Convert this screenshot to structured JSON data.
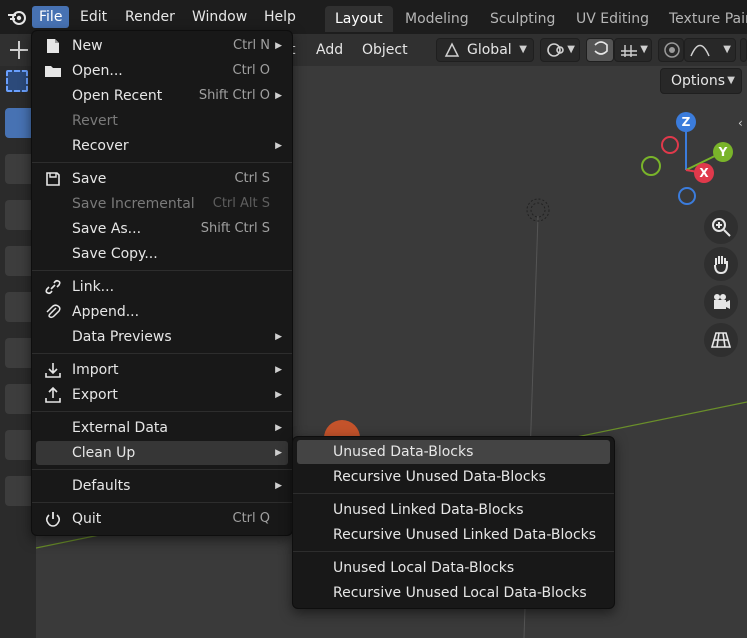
{
  "topbar": {
    "menus": [
      "File",
      "Edit",
      "Render",
      "Window",
      "Help"
    ],
    "workspaces": [
      "Layout",
      "Modeling",
      "Sculpting",
      "UV Editing",
      "Texture Paint"
    ]
  },
  "header": {
    "add_label": "Add",
    "object_label": "Object",
    "orientation": "Global",
    "partial_label": "t"
  },
  "viewport": {
    "options_label": "Options",
    "gizmo": {
      "z": "Z",
      "y": "Y",
      "x": "X"
    }
  },
  "file_menu": {
    "items": [
      {
        "label": "New",
        "shortcut": "Ctrl N",
        "submenu": true,
        "disabled": false,
        "icon": "new-file-icon"
      },
      {
        "label": "Open...",
        "shortcut": "Ctrl O",
        "submenu": false,
        "disabled": false,
        "icon": "folder-icon"
      },
      {
        "label": "Open Recent",
        "shortcut": "Shift Ctrl O",
        "submenu": true,
        "disabled": false,
        "icon": ""
      },
      {
        "label": "Revert",
        "shortcut": "",
        "submenu": false,
        "disabled": true,
        "icon": ""
      },
      {
        "label": "Recover",
        "shortcut": "",
        "submenu": true,
        "disabled": false,
        "icon": ""
      },
      {
        "label": "Save",
        "shortcut": "Ctrl S",
        "submenu": false,
        "disabled": false,
        "icon": "save-icon"
      },
      {
        "label": "Save Incremental",
        "shortcut": "Ctrl Alt S",
        "submenu": false,
        "disabled": true,
        "icon": ""
      },
      {
        "label": "Save As...",
        "shortcut": "Shift Ctrl S",
        "submenu": false,
        "disabled": false,
        "icon": ""
      },
      {
        "label": "Save Copy...",
        "shortcut": "",
        "submenu": false,
        "disabled": false,
        "icon": ""
      },
      {
        "label": "Link...",
        "shortcut": "",
        "submenu": false,
        "disabled": false,
        "icon": "link-icon"
      },
      {
        "label": "Append...",
        "shortcut": "",
        "submenu": false,
        "disabled": false,
        "icon": "paperclip-icon"
      },
      {
        "label": "Data Previews",
        "shortcut": "",
        "submenu": true,
        "disabled": false,
        "icon": ""
      },
      {
        "label": "Import",
        "shortcut": "",
        "submenu": true,
        "disabled": false,
        "icon": "import-icon"
      },
      {
        "label": "Export",
        "shortcut": "",
        "submenu": true,
        "disabled": false,
        "icon": "export-icon"
      },
      {
        "label": "External Data",
        "shortcut": "",
        "submenu": true,
        "disabled": false,
        "icon": ""
      },
      {
        "label": "Clean Up",
        "shortcut": "",
        "submenu": true,
        "disabled": false,
        "icon": ""
      },
      {
        "label": "Defaults",
        "shortcut": "",
        "submenu": true,
        "disabled": false,
        "icon": ""
      },
      {
        "label": "Quit",
        "shortcut": "Ctrl Q",
        "submenu": false,
        "disabled": false,
        "icon": "power-icon"
      }
    ]
  },
  "cleanup_menu": {
    "items": [
      "Unused Data-Blocks",
      "Recursive Unused Data-Blocks",
      "Unused Linked Data-Blocks",
      "Recursive Unused Linked Data-Blocks",
      "Unused Local Data-Blocks",
      "Recursive Unused Local Data-Blocks"
    ]
  },
  "colors": {
    "accent": "#4772b3",
    "axis_x": "#e0394b",
    "axis_y": "#79b42a",
    "axis_z": "#3b7cdc"
  }
}
